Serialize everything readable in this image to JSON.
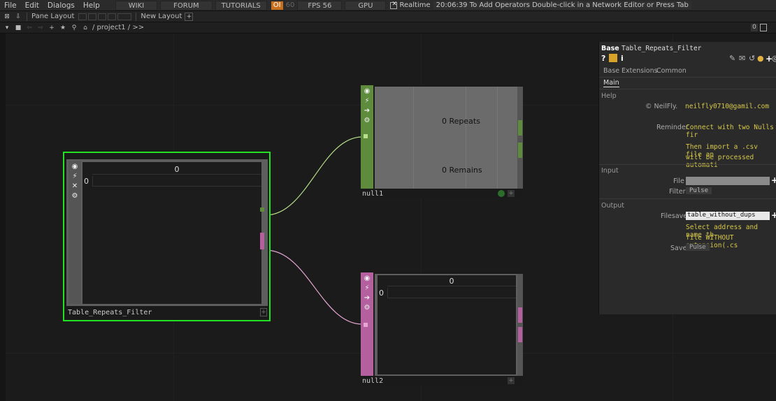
{
  "menu": [
    "File",
    "Edit",
    "Dialogs",
    "Help"
  ],
  "toolbar": {
    "wiki": "WIKI",
    "forum": "FORUM",
    "tutorials": "TUTORIALS",
    "oi": "OI",
    "fps_target": "60",
    "fps_label": "FPS 56",
    "gpu": "GPU",
    "realtime": "Realtime",
    "status": "20:06:39 To Add Operators Double-click in a Network Editor or Press Tab"
  },
  "pane": {
    "pane_layout": "Pane Layout",
    "new_layout": "New Layout"
  },
  "path": {
    "text": "/ project1 / >>"
  },
  "nodes": {
    "main": {
      "name": "Table_Repeats_Filter",
      "header": "0",
      "row0": "0"
    },
    "null1": {
      "name": "null1",
      "repeats": "0 Repeats",
      "remains": "0 Remains"
    },
    "null2": {
      "name": "null2",
      "header": "0",
      "row0": "0"
    }
  },
  "panel": {
    "type": "Base",
    "name": "Table_Repeats_Filter",
    "tabs": [
      "Base",
      "Extensions",
      "Common"
    ],
    "page": "Main",
    "help_label": "Help",
    "copyright_prefix": "© NeilFly.",
    "email": "neilfly0710@gamil.com",
    "reminder_label": "Reminder",
    "reminder1": "Connect with two Nulls fir",
    "reminder2": "Then import a .csv file an",
    "reminder3": "will be processed automati",
    "input_label": "Input",
    "file_label": "File",
    "filter_label": "Filter",
    "pulse": "Pulse",
    "output_label": "Output",
    "filesave_label": "Filesave",
    "filesave_value": "table_without_dups",
    "out1": "Select address and name th",
    "out2": "file WITHOUT extension(.cs",
    "save_label": "Save",
    "zero": "0"
  },
  "colors": {
    "green": "#5f8c3c",
    "pink": "#b45f9e",
    "select": "#22e022",
    "wire_green": "#b8e08a",
    "wire_pink": "#e6a6d2"
  }
}
